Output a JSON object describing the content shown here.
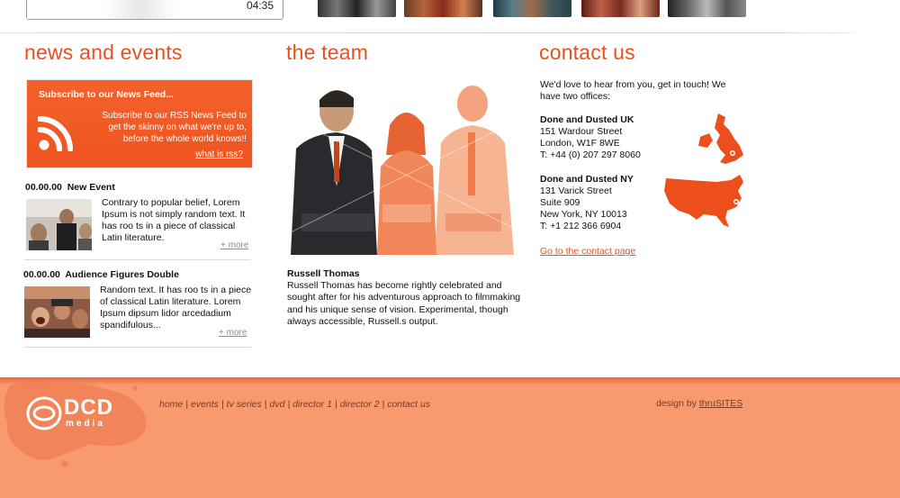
{
  "top": {
    "player_time": "04:35",
    "thumbnails": [
      "video-thumb-1",
      "video-thumb-2",
      "video-thumb-3",
      "video-thumb-4",
      "video-thumb-5"
    ]
  },
  "news": {
    "title": "news and events",
    "feed": {
      "title": "Subscribe to our News Feed...",
      "text": "Subscribe to our RSS News Feed to get the skinny on what we're up to, before the whole world knows!!",
      "link": "what is rss?",
      "icon": "rss-icon"
    },
    "items": [
      {
        "date": "00.00.00",
        "title": "New Event",
        "text": "Contrary to popular belief, Lorem Ipsum is not simply random text. It has roo ts in a piece of classical Latin literature.",
        "more": "+ more"
      },
      {
        "date": "00.00.00",
        "title": "Audience Figures Double",
        "text": "Random text. It has roo ts in a piece of classical Latin literature. Lorem Ipsum dipsum lidor arcedadium spandifulous...",
        "more": "+ more"
      }
    ]
  },
  "team": {
    "title": "the team",
    "name": "Russell Thomas",
    "bio": "Russell Thomas has become rightly celebrated and sought after for his adventurous approach to filmmaking and his unique sense of vision. Experimental, though always accessible, Russell.s output."
  },
  "contact": {
    "title": "contact us",
    "intro": "We'd love to hear from you, get in touch! We have two offices:",
    "offices": [
      {
        "name": "Done and Dusted UK",
        "lines": [
          "151 Wardour Street",
          "London, W1F 8WE",
          "T: +44 (0) 207 297 8060"
        ]
      },
      {
        "name": "Done and Dusted NY",
        "lines": [
          "131 Varick Street",
          "Suite 909",
          "New York, NY 10013",
          "T: +1 212 366 6904"
        ]
      }
    ],
    "link": "Go to the contact page"
  },
  "footer": {
    "logo_text": "DCD",
    "logo_sub": "media",
    "nav": [
      "home",
      "events",
      "tv series",
      "dvd",
      "director 1",
      "director 2",
      "contact us"
    ],
    "design_prefix": "design by",
    "design_link": "thruSITES"
  },
  "colors": {
    "accent": "#e8511f",
    "footer": "#f89970"
  }
}
